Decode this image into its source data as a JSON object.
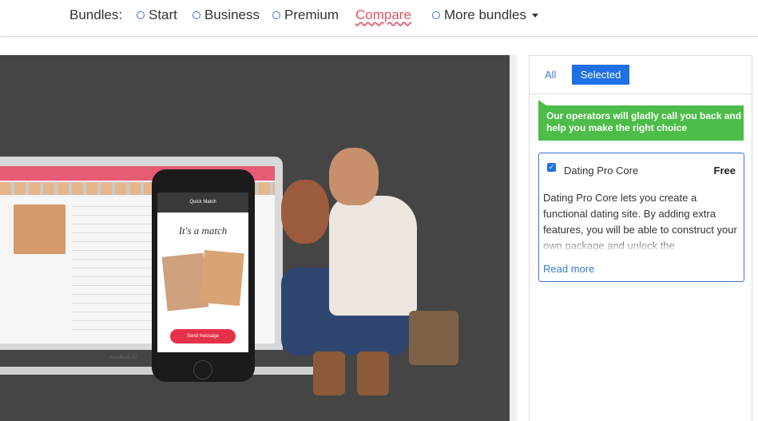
{
  "topbar": {
    "label": "Bundles:",
    "options": [
      "Start",
      "Business",
      "Premium"
    ],
    "compare": "Compare",
    "more": "More bundles"
  },
  "hero": {
    "phone_title": "Quick Match",
    "phone_match": "It's a match",
    "phone_button": "Send message",
    "laptop_label": "MacBook Air"
  },
  "panel": {
    "tab_all": "All",
    "tab_selected": "Selected",
    "callout": "Our operators will gladly call you back and help you make the right choice",
    "product": {
      "name": "Dating Pro Core",
      "price": "Free",
      "description": "Dating Pro Core lets you create a functional dating site. By adding extra features, you will be able to construct your own package and unlock the",
      "read_more": "Read more",
      "checked": true
    }
  },
  "colors": {
    "accent": "#1f6fe5",
    "compare": "#e25663",
    "callout": "#4cbd48",
    "hero_bg": "#454545"
  }
}
